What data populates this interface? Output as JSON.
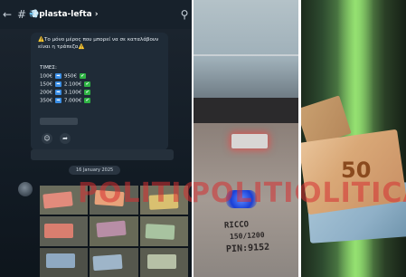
{
  "chat": {
    "back_icon": "back-arrow-icon",
    "hash": "#",
    "title": "💨plasta-lefta ›",
    "search_icon": "search-icon",
    "warning_text": "⚠️Το μόνο μέρος που μπορεί να σε καταλάβουν είναι η τράπεζα⚠️",
    "prices_title": "ΤΙΜΕΣ:",
    "prices": [
      {
        "left": "100€",
        "right": "950€"
      },
      {
        "left": "150€",
        "right": "2.100€"
      },
      {
        "left": "200€",
        "right": "3.100€"
      },
      {
        "left": "350€",
        "right": "7.000€"
      }
    ],
    "arrow_glyph": "➡",
    "check_glyph": "✔",
    "reaction_icons": [
      "smiley-icon",
      "share-icon"
    ],
    "date_pill": "16 January 2025"
  },
  "watermark": "POLITICAL",
  "desk_note": {
    "line1": "RICCO",
    "line2": "150/1200",
    "line3": "PIN:9152"
  },
  "banknote": {
    "denomination": "50"
  },
  "colors": {
    "chat_bg": "#17212b",
    "warning": "#f5c518",
    "check_green": "#2fb344",
    "arrow_blue": "#3a8ee6",
    "watermark_red": "#d63031"
  }
}
